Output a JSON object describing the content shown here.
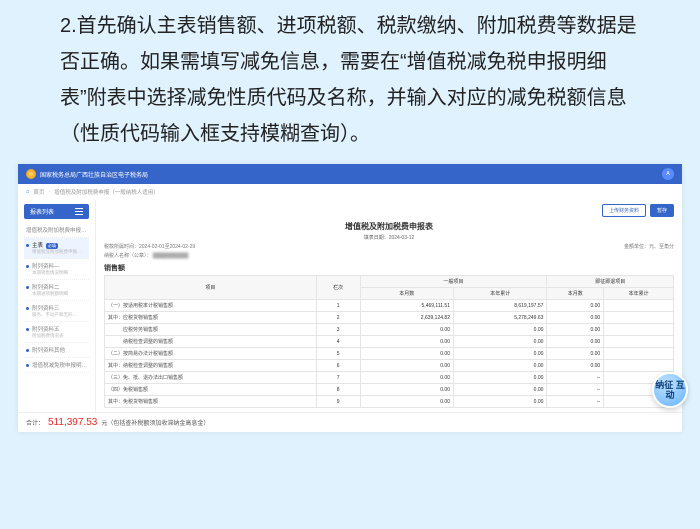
{
  "instruction": "2.首先确认主表销售额、进项税额、税款缴纳、附加税费等数据是否正确。如果需填写减免信息，需要在“增值税减免税申报明细表”附表中选择减免性质代码及名称，并输入对应的减免税额信息（性质代码输入框支持模糊查询）。",
  "titlebar": {
    "title": "国家税务总局广西壮族自治区电子税务局",
    "user_initial": "A"
  },
  "breadcrumb": {
    "home": "首页",
    "tab": "增值税及附加税费申报（一般纳税人适用）"
  },
  "sidebar": {
    "header": "报表列表",
    "group0": "增值税及附加税费申报…",
    "items": [
      {
        "label": "主表",
        "badge": "必填",
        "sub": "增值税及附加税费申报…",
        "active": true
      },
      {
        "label": "附列资料—",
        "sub": "本期销售情况明细"
      },
      {
        "label": "附列资料二",
        "sub": "本期进项税额明细"
      },
      {
        "label": "附列资料三",
        "sub": "服务、不动产和无形…"
      },
      {
        "label": "附列资料五",
        "sub": "附加税费情况表"
      },
      {
        "label": "附列资料其他",
        "sub": ""
      },
      {
        "label": "增值税减免税申报明…",
        "sub": ""
      }
    ]
  },
  "actions": {
    "upload": "上传财务资料",
    "temp": "暂存"
  },
  "form": {
    "title": "增值税及附加税费申报表",
    "period_label": "填表日期：2024-03-12",
    "period": "税款所属时间：2024-02-01至2024-02-29",
    "taxpayer": "纳税人名称（公章）：",
    "blurred": "██████████",
    "unit": "金额单位：元、至角分",
    "section": "销售额",
    "thead": {
      "col_item": "项目",
      "col_seq": "栏次",
      "group1": "一般项目",
      "group2": "即征即退项目",
      "sub_bym": "本月数",
      "sub_byl": "本年累计",
      "sub_bym2": "本月数",
      "sub_byl2": "本年累计"
    },
    "rows": [
      {
        "label": "（一）按适用税率计税销售额",
        "seq": "1",
        "a": "5,469,111.51",
        "b": "",
        "c": "8,619,197.57",
        "d": "",
        "e": "0.00",
        "f": ""
      },
      {
        "label": "其中：应税货物销售额",
        "seq": "2",
        "a": "2,639,124.82",
        "b": "",
        "c": "5,278,249.63",
        "d": "",
        "e": "0.00",
        "f": ""
      },
      {
        "label": "　　　应税劳务销售额",
        "seq": "3",
        "a": "0.00",
        "b": "",
        "c": "0.00",
        "d": "",
        "e": "0.00",
        "f": ""
      },
      {
        "label": "　　　纳税检查调整的销售额",
        "seq": "4",
        "a": "0.00",
        "b": "",
        "c": "0.00",
        "d": "",
        "e": "0.00",
        "f": ""
      },
      {
        "label": "（二）按简易办法计税销售额",
        "seq": "5",
        "a": "0.00",
        "b": "",
        "c": "0.00",
        "d": "",
        "e": "0.00",
        "f": ""
      },
      {
        "label": "其中：纳税检查调整的销售额",
        "seq": "6",
        "a": "0.00",
        "b": "",
        "c": "0.00",
        "d": "",
        "e": "0.00",
        "f": ""
      },
      {
        "label": "（三）免、抵、退办法出口销售额",
        "seq": "7",
        "a": "0.00",
        "b": "",
        "c": "0.00",
        "d": "",
        "e": "--",
        "f": "--"
      },
      {
        "label": "（四）免税销售额",
        "seq": "8",
        "a": "0.00",
        "b": "",
        "c": "0.00",
        "d": "",
        "e": "--",
        "f": "--"
      },
      {
        "label": "其中：免税货物销售额",
        "seq": "9",
        "a": "0.00",
        "b": "",
        "c": "0.00",
        "d": "",
        "e": "--",
        "f": "--"
      }
    ]
  },
  "footer": {
    "label": "合计：",
    "amount": "511,397.53",
    "suffix": "元（包括查补税额须加收滞纳金高息金）"
  },
  "float_label": "纳征\n互动"
}
